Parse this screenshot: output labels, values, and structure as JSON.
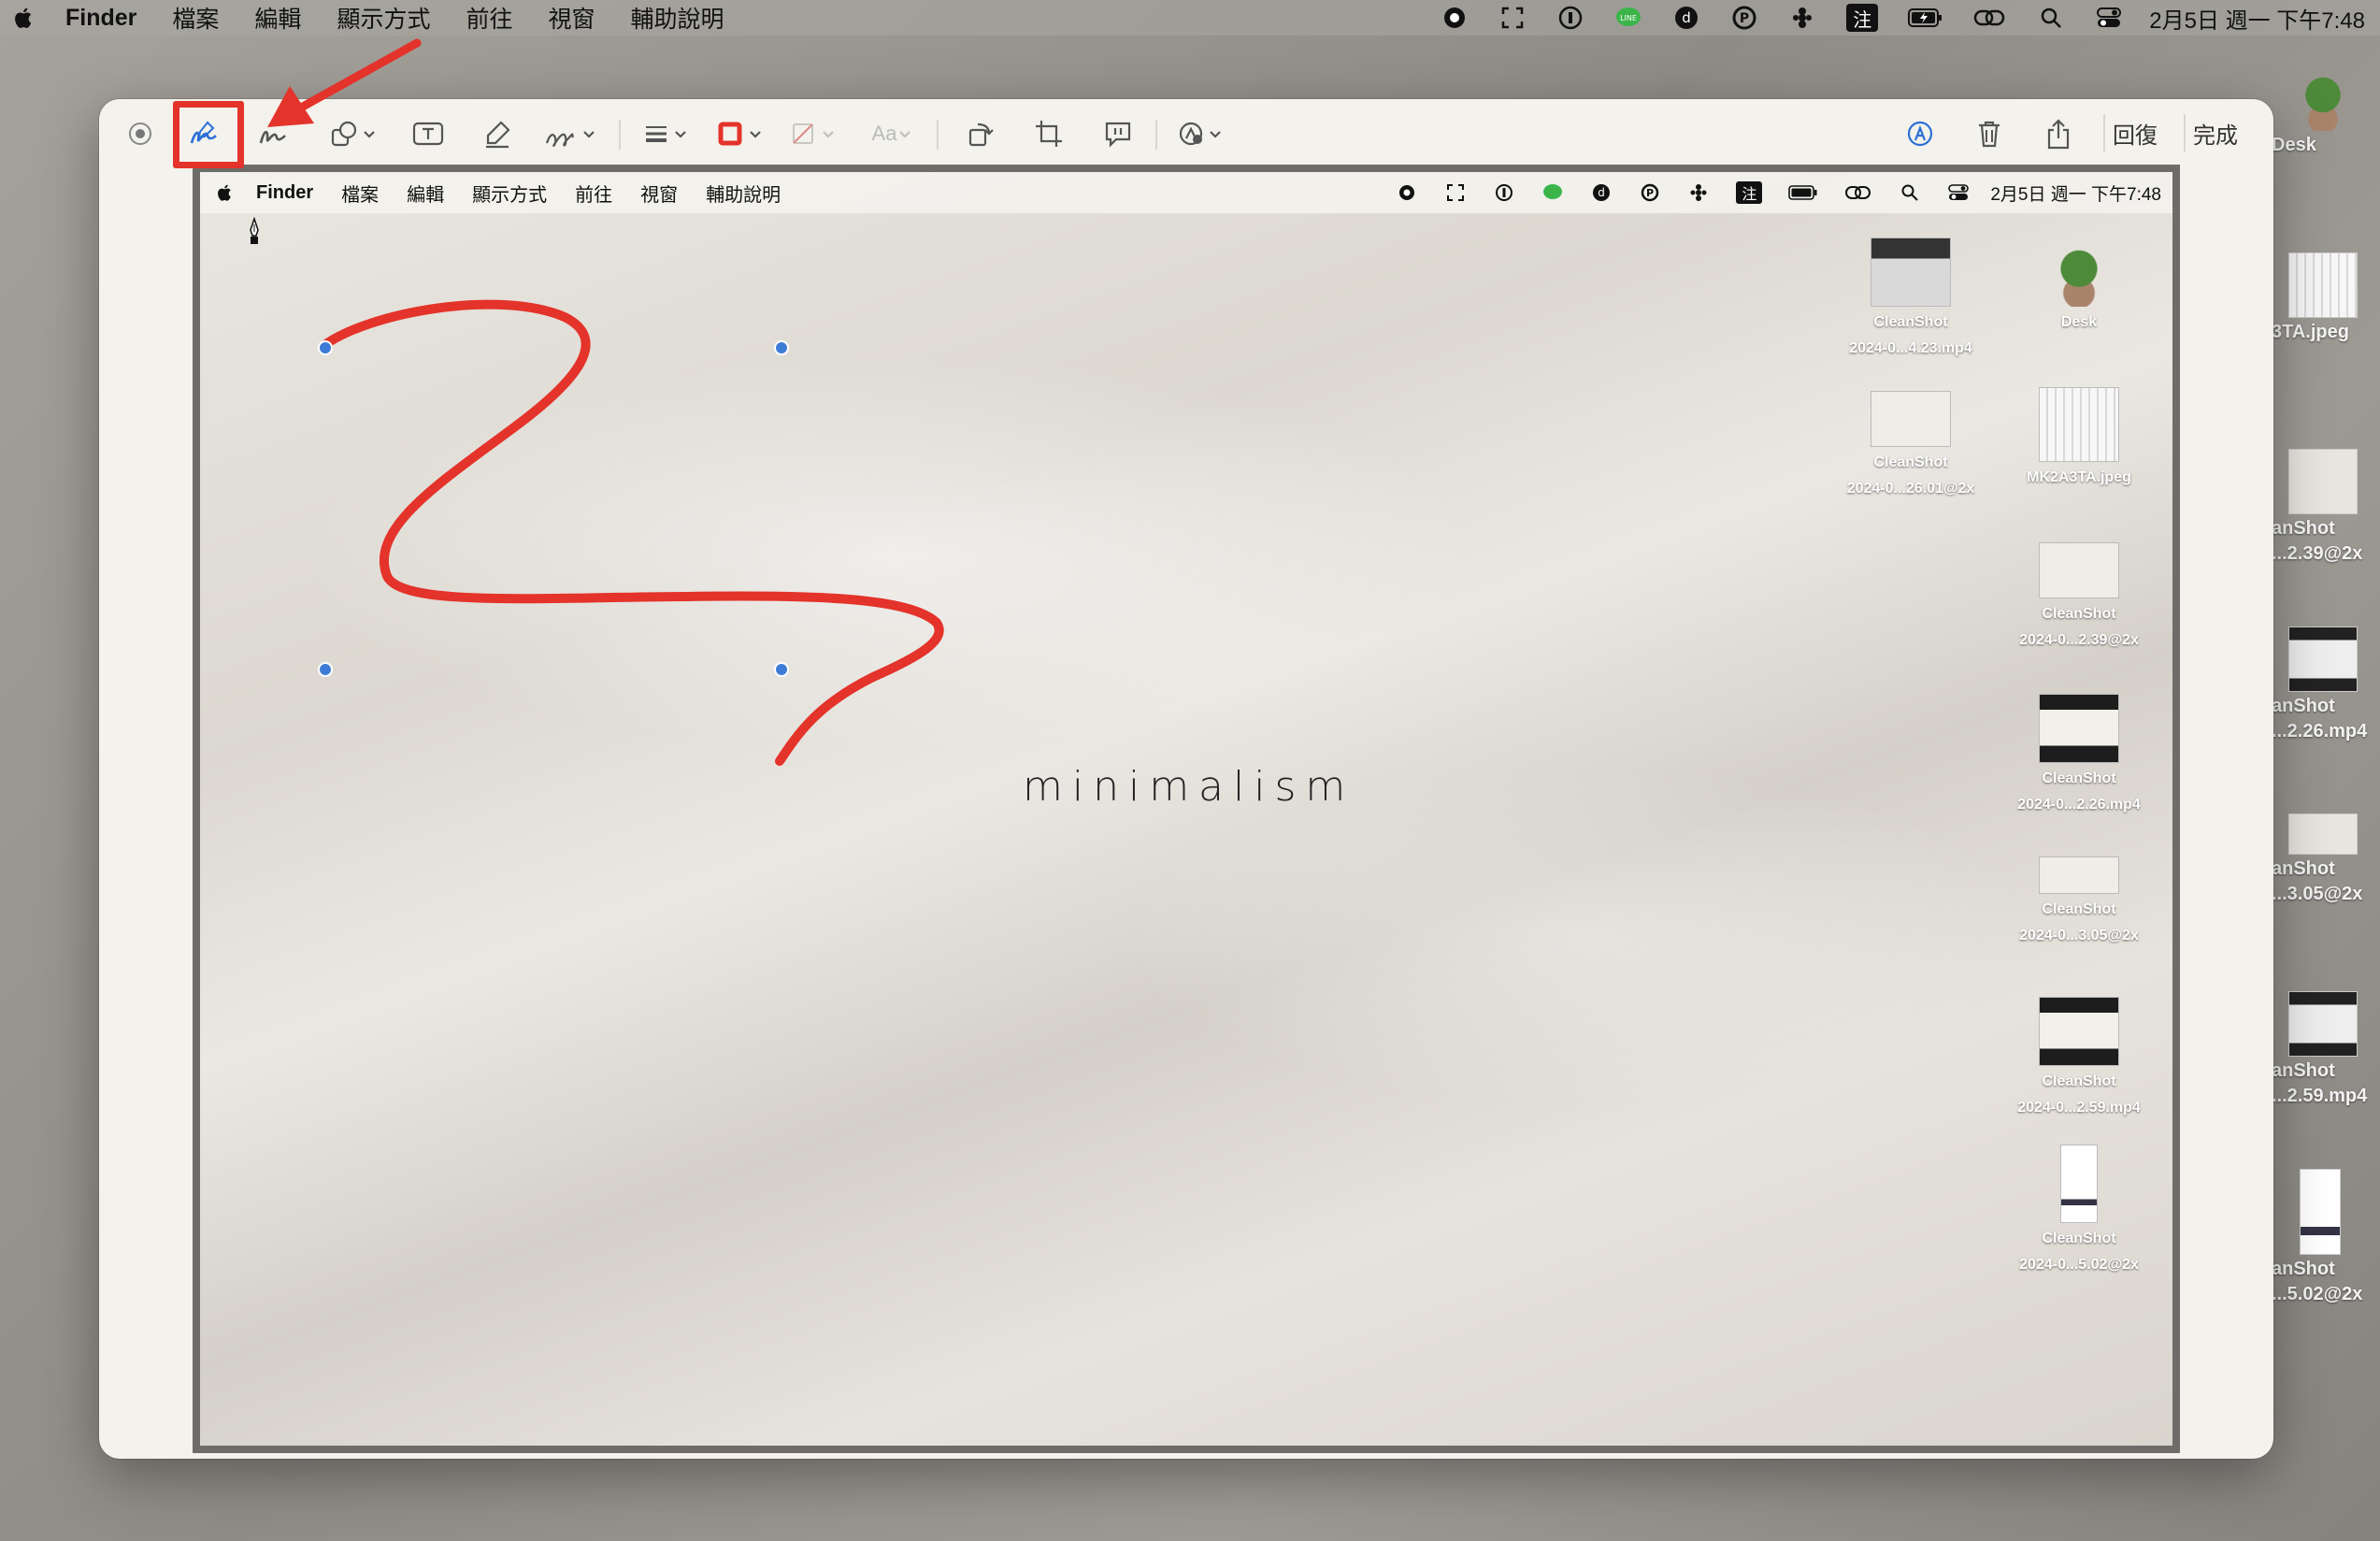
{
  "menubar": {
    "app_name": "Finder",
    "menus": [
      "檔案",
      "編輯",
      "顯示方式",
      "前往",
      "視窗",
      "輔助說明"
    ],
    "clock": "2月5日 週一 下午7:48",
    "status_icons": [
      "record-icon",
      "fullscreen-icon",
      "1password-icon",
      "line-icon",
      "d-app-icon",
      "p-app-icon",
      "figma-icon",
      "zhuyin-input-icon",
      "battery-icon",
      "link-icon",
      "search-icon",
      "control-center-icon"
    ],
    "input_method": "注"
  },
  "toolbar": {
    "sketch": "sketch-icon",
    "draw": "draw-icon",
    "shapes": "shapes-icon",
    "text": "text-box-icon",
    "highlight": "highlight-icon",
    "sign": "signature-icon",
    "line_style": "line-style-icon",
    "border_color": "border-color-icon",
    "fill_color": "fill-color-icon",
    "text_style": "Aa",
    "rotate": "rotate-icon",
    "crop": "crop-icon",
    "description": "description-icon",
    "more": "markup-more-icon",
    "auto_markup": "auto-markup-icon",
    "delete": "trash-icon",
    "share": "share-icon",
    "revert_label": "回復",
    "done_label": "完成"
  },
  "canvas": {
    "wallpaper_text": "minimalism",
    "menubar": {
      "app_name": "Finder",
      "menus": [
        "檔案",
        "編輯",
        "顯示方式",
        "前往",
        "視窗",
        "輔助說明"
      ],
      "clock": "2月5日 週一 下午7:48",
      "input_method": "注"
    },
    "desktop_icons": [
      {
        "line1": "CleanShot",
        "line2": "2024-0...4.23.mp4",
        "kind": "screen"
      },
      {
        "line1": "Desk",
        "line2": "",
        "kind": "plant"
      },
      {
        "line1": "CleanShot",
        "line2": "2024-0...26.01@2x",
        "kind": "plain"
      },
      {
        "line1": "MK2A3TA.jpeg",
        "line2": "",
        "kind": "keyboard"
      },
      {
        "line1": "CleanShot",
        "line2": "2024-0...2.39@2x",
        "kind": "plain"
      },
      {
        "line1": "CleanShot",
        "line2": "2024-0...2.26.mp4",
        "kind": "dark"
      },
      {
        "line1": "CleanShot",
        "line2": "2024-0...3.05@2x",
        "kind": "plain"
      },
      {
        "line1": "CleanShot",
        "line2": "2024-0...2.59.mp4",
        "kind": "dark"
      },
      {
        "line1": "CleanShot",
        "line2": "2024-0...5.02@2x",
        "kind": "doc"
      }
    ],
    "stroke_color": "#e4332a",
    "handle_color": "#3d7bd6"
  },
  "outer_desktop_icons": [
    {
      "label": "Desk"
    },
    {
      "label": "3TA.jpeg"
    },
    {
      "label": "anShot",
      "label2": "...2.39@2x"
    },
    {
      "label": "anShot",
      "label2": "...2.26.mp4"
    },
    {
      "label": "anShot",
      "label2": "...3.05@2x"
    },
    {
      "label": "anShot",
      "label2": "...2.59.mp4"
    },
    {
      "label": "anShot",
      "label2": "...5.02@2x"
    }
  ],
  "annotation": {
    "highlight_color": "#e4332a"
  }
}
